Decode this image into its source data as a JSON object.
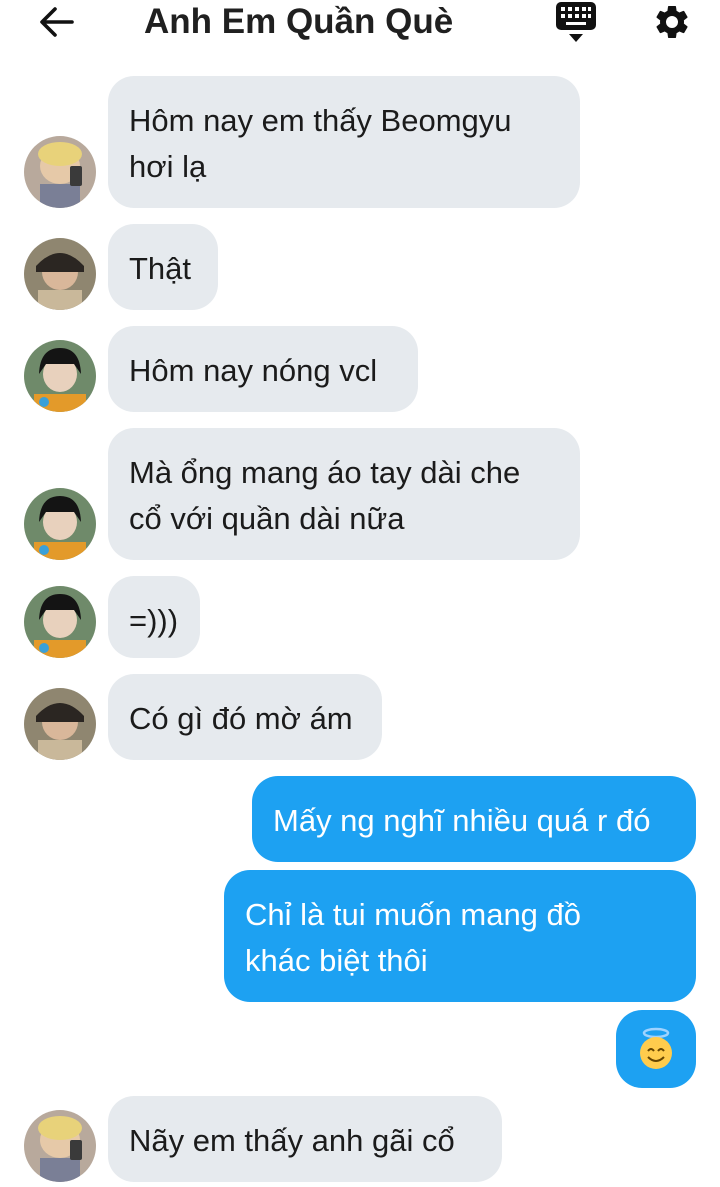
{
  "header": {
    "title": "Anh Em Quần Què",
    "back_icon": "arrow-left-icon",
    "keyboard_icon": "keyboard-icon",
    "settings_icon": "gear-icon"
  },
  "colors": {
    "incoming_bubble": "#e6eaee",
    "outgoing_bubble": "#1da1f2",
    "outgoing_text": "#ffffff"
  },
  "messages": [
    {
      "direction": "incoming",
      "avatar": "avatar-blond",
      "text": "Hôm nay em thấy Beomgyu\nhơi lạ"
    },
    {
      "direction": "incoming",
      "avatar": "avatar-dark-hat",
      "text": "Thật"
    },
    {
      "direction": "incoming",
      "avatar": "avatar-dark-hair",
      "text": "Hôm nay nóng vcl"
    },
    {
      "direction": "incoming",
      "avatar": "avatar-dark-hair",
      "text": "Mà ổng mang áo tay dài che\ncổ với quần dài nữa"
    },
    {
      "direction": "incoming",
      "avatar": "avatar-dark-hair",
      "text": "=)))"
    },
    {
      "direction": "incoming",
      "avatar": "avatar-dark-hat",
      "text": "Có gì đó mờ ám"
    },
    {
      "direction": "outgoing",
      "text": "Mấy ng nghĩ nhiều quá r đó"
    },
    {
      "direction": "outgoing",
      "text": "Chỉ là tui muốn mang đồ\nkhác biệt thôi"
    },
    {
      "direction": "outgoing",
      "text": "😇"
    },
    {
      "direction": "incoming",
      "avatar": "avatar-blond",
      "text": "Nãy em thấy anh gãi cổ"
    }
  ]
}
